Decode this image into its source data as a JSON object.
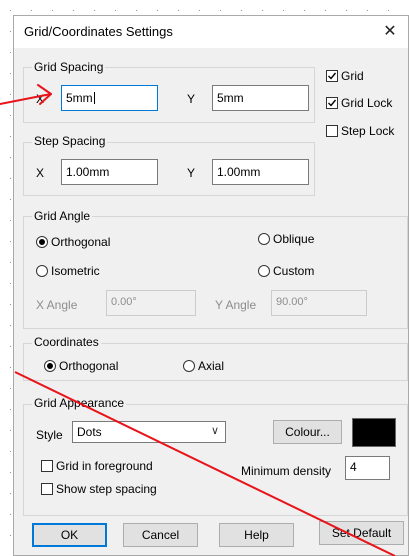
{
  "dialog": {
    "title": "Grid/Coordinates Settings",
    "close_glyph": "✕"
  },
  "grid_spacing": {
    "label": "Grid Spacing",
    "x_label": "X",
    "x_value": "5mm",
    "y_label": "Y",
    "y_value": "5mm"
  },
  "options": {
    "grid": "Grid",
    "grid_checked": true,
    "grid_lock": "Grid Lock",
    "grid_lock_checked": true,
    "step_lock": "Step Lock",
    "step_lock_checked": false
  },
  "step_spacing": {
    "label": "Step Spacing",
    "x_label": "X",
    "x_value": "1.00mm",
    "y_label": "Y",
    "y_value": "1.00mm"
  },
  "grid_angle": {
    "label": "Grid Angle",
    "orthogonal": "Orthogonal",
    "oblique": "Oblique",
    "isometric": "Isometric",
    "custom": "Custom",
    "selected": "orthogonal",
    "x_angle_label": "X Angle",
    "x_angle_value": "0.00°",
    "y_angle_label": "Y Angle",
    "y_angle_value": "90.00°"
  },
  "coordinates": {
    "label": "Coordinates",
    "orthogonal": "Orthogonal",
    "axial": "Axial",
    "selected": "orthogonal"
  },
  "appearance": {
    "label": "Grid Appearance",
    "style_label": "Style",
    "style_value": "Dots",
    "colour_button": "Colour...",
    "colour_value": "#000000",
    "foreground": "Grid in foreground",
    "foreground_checked": false,
    "show_step": "Show step spacing",
    "show_step_checked": false,
    "min_density_label": "Minimum density",
    "min_density_value": "4"
  },
  "buttons": {
    "ok": "OK",
    "cancel": "Cancel",
    "help": "Help",
    "set_default": "Set Default"
  },
  "annotations": {
    "color": "#e8141a"
  },
  "colors": {
    "focus": "#0078d7",
    "dialog_bg": "#f0f0f0"
  }
}
